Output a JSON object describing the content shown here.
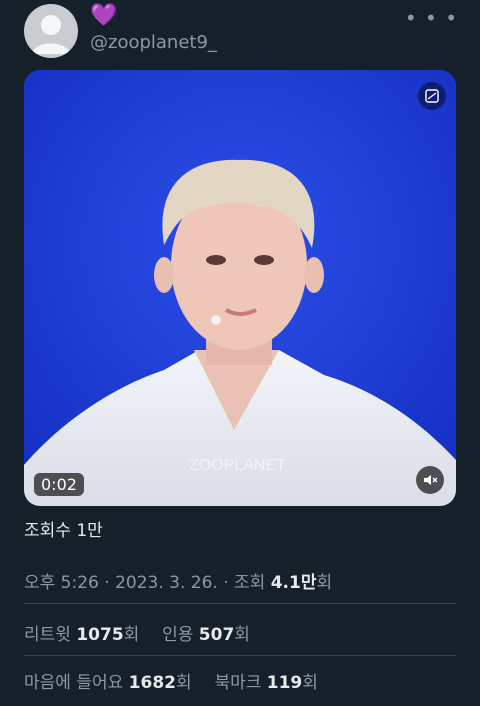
{
  "account": {
    "heart": "💜",
    "handle": "@zooplanet9_"
  },
  "media": {
    "duration": "0:02",
    "watermark": "ZOOPLANET"
  },
  "views_line": "조회수 1만",
  "meta": {
    "time": "오후 5:26",
    "sep1": "·",
    "date": "2023. 3. 26.",
    "sep2": "·",
    "views_label": "조회",
    "views_value": "4.1만",
    "views_suffix": "회"
  },
  "stats1": {
    "retweet_label": "리트윗",
    "retweet_value": "1075",
    "retweet_suffix": "회",
    "quote_label": "인용",
    "quote_value": "507",
    "quote_suffix": "회"
  },
  "stats2": {
    "like_label": "마음에 들어요",
    "like_value": "1682",
    "like_suffix": "회",
    "bookmark_label": "북마크",
    "bookmark_value": "119",
    "bookmark_suffix": "회"
  }
}
